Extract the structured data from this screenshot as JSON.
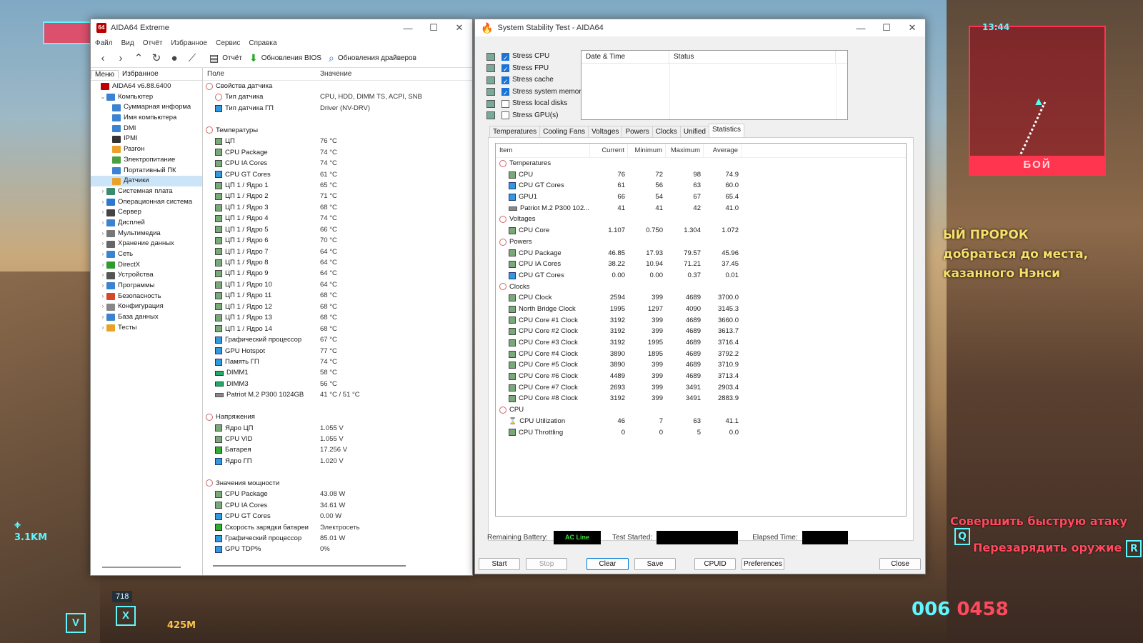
{
  "game_hud": {
    "clock": "13:44",
    "minimap_label": "БОЙ",
    "quest_title": "ЫЙ ПРОРОК",
    "quest_line1": "добраться до места,",
    "quest_line2": "казанного Нэнси",
    "hint_attack": "Совершить быструю атаку",
    "hint_attack_key": "Q",
    "hint_reload": "Перезарядить оружие",
    "hint_reload_key": "R",
    "ammo_main": "006",
    "ammo_reserve": "0458",
    "distance": "3.1KM",
    "distance2": "425M",
    "hud_num": "718",
    "slot_x": "X",
    "slot_v": "V"
  },
  "aida": {
    "title": "AIDA64 Extreme",
    "app_icon": "64",
    "menu": [
      "Файл",
      "Вид",
      "Отчёт",
      "Избранное",
      "Сервис",
      "Справка"
    ],
    "toolbar": {
      "report": "Отчёт",
      "bios": "Обновления BIOS",
      "drivers": "Обновления драйверов"
    },
    "pane_tabs": {
      "menu": "Меню",
      "favorites": "Избранное"
    },
    "tree": [
      {
        "label": "AIDA64 v6.88.6400",
        "level": 0,
        "color": "#c00000",
        "exp": ""
      },
      {
        "label": "Компьютер",
        "level": 1,
        "color": "#3b83d1",
        "exp": "⌄"
      },
      {
        "label": "Суммарная информа",
        "level": 2,
        "color": "#3b83d1",
        "exp": ""
      },
      {
        "label": "Имя компьютера",
        "level": 2,
        "color": "#3b83d1",
        "exp": ""
      },
      {
        "label": "DMI",
        "level": 2,
        "color": "#3b83d1",
        "exp": ""
      },
      {
        "label": "IPMI",
        "level": 2,
        "color": "#333333",
        "exp": ""
      },
      {
        "label": "Разгон",
        "level": 2,
        "color": "#e8a22a",
        "exp": ""
      },
      {
        "label": "Электропитание",
        "level": 2,
        "color": "#4aa040",
        "exp": ""
      },
      {
        "label": "Портативный ПК",
        "level": 2,
        "color": "#3b83d1",
        "exp": ""
      },
      {
        "label": "Датчики",
        "level": 2,
        "color": "#e8a22a",
        "exp": "",
        "selected": true
      },
      {
        "label": "Системная плата",
        "level": 1,
        "color": "#3b8a6a",
        "exp": "›"
      },
      {
        "label": "Операционная система",
        "level": 1,
        "color": "#2a78d6",
        "exp": "›"
      },
      {
        "label": "Сервер",
        "level": 1,
        "color": "#444444",
        "exp": "›"
      },
      {
        "label": "Дисплей",
        "level": 1,
        "color": "#3b83d1",
        "exp": "›"
      },
      {
        "label": "Мультимедиа",
        "level": 1,
        "color": "#777777",
        "exp": "›"
      },
      {
        "label": "Хранение данных",
        "level": 1,
        "color": "#666666",
        "exp": "›"
      },
      {
        "label": "Сеть",
        "level": 1,
        "color": "#3b83d1",
        "exp": "›"
      },
      {
        "label": "DirectX",
        "level": 1,
        "color": "#2f9a2f",
        "exp": "›"
      },
      {
        "label": "Устройства",
        "level": 1,
        "color": "#555555",
        "exp": "›"
      },
      {
        "label": "Программы",
        "level": 1,
        "color": "#3b83d1",
        "exp": "›"
      },
      {
        "label": "Безопасность",
        "level": 1,
        "color": "#d6472a",
        "exp": "›"
      },
      {
        "label": "Конфигурация",
        "level": 1,
        "color": "#888888",
        "exp": "›"
      },
      {
        "label": "База данных",
        "level": 1,
        "color": "#3b83d1",
        "exp": "›"
      },
      {
        "label": "Тесты",
        "level": 1,
        "color": "#e8a22a",
        "exp": "›"
      }
    ],
    "columns": {
      "field": "Поле",
      "value": "Значение"
    },
    "sensors": [
      {
        "type": "group",
        "name": "Свойства датчика",
        "value": ""
      },
      {
        "type": "item",
        "name": "Тип датчика",
        "value": "CPU, HDD, DIMM TS, ACPI, SNB",
        "icon": "gi"
      },
      {
        "type": "item",
        "name": "Тип датчика ГП",
        "value": "Driver  (NV-DRV)",
        "icon": "blue"
      },
      {
        "type": "space"
      },
      {
        "type": "group",
        "name": "Температуры",
        "value": ""
      },
      {
        "type": "item",
        "name": "ЦП",
        "value": "76 °C",
        "icon": "std"
      },
      {
        "type": "item",
        "name": "CPU Package",
        "value": "74 °C",
        "icon": "std"
      },
      {
        "type": "item",
        "name": "CPU IA Cores",
        "value": "74 °C",
        "icon": "std"
      },
      {
        "type": "item",
        "name": "CPU GT Cores",
        "value": "61 °C",
        "icon": "blue"
      },
      {
        "type": "item",
        "name": "ЦП 1 / Ядро 1",
        "value": "65 °C",
        "icon": "std"
      },
      {
        "type": "item",
        "name": "ЦП 1 / Ядро 2",
        "value": "71 °C",
        "icon": "std"
      },
      {
        "type": "item",
        "name": "ЦП 1 / Ядро 3",
        "value": "68 °C",
        "icon": "std"
      },
      {
        "type": "item",
        "name": "ЦП 1 / Ядро 4",
        "value": "74 °C",
        "icon": "std"
      },
      {
        "type": "item",
        "name": "ЦП 1 / Ядро 5",
        "value": "66 °C",
        "icon": "std"
      },
      {
        "type": "item",
        "name": "ЦП 1 / Ядро 6",
        "value": "70 °C",
        "icon": "std"
      },
      {
        "type": "item",
        "name": "ЦП 1 / Ядро 7",
        "value": "64 °C",
        "icon": "std"
      },
      {
        "type": "item",
        "name": "ЦП 1 / Ядро 8",
        "value": "64 °C",
        "icon": "std"
      },
      {
        "type": "item",
        "name": "ЦП 1 / Ядро 9",
        "value": "64 °C",
        "icon": "std"
      },
      {
        "type": "item",
        "name": "ЦП 1 / Ядро 10",
        "value": "64 °C",
        "icon": "std"
      },
      {
        "type": "item",
        "name": "ЦП 1 / Ядро 11",
        "value": "68 °C",
        "icon": "std"
      },
      {
        "type": "item",
        "name": "ЦП 1 / Ядро 12",
        "value": "68 °C",
        "icon": "std"
      },
      {
        "type": "item",
        "name": "ЦП 1 / Ядро 13",
        "value": "68 °C",
        "icon": "std"
      },
      {
        "type": "item",
        "name": "ЦП 1 / Ядро 14",
        "value": "68 °C",
        "icon": "std"
      },
      {
        "type": "item",
        "name": "Графический процессор",
        "value": "67 °C",
        "icon": "blue"
      },
      {
        "type": "item",
        "name": "GPU Hotspot",
        "value": "77 °C",
        "icon": "blue"
      },
      {
        "type": "item",
        "name": "Память ГП",
        "value": "74 °C",
        "icon": "blue"
      },
      {
        "type": "item",
        "name": "DIMM1",
        "value": "58 °C",
        "icon": "ram"
      },
      {
        "type": "item",
        "name": "DIMM3",
        "value": "56 °C",
        "icon": "ram"
      },
      {
        "type": "item",
        "name": "Patriot M.2 P300 1024GB",
        "value": "41 °C / 51 °C",
        "icon": "disk"
      },
      {
        "type": "space"
      },
      {
        "type": "group",
        "name": "Напряжения",
        "value": ""
      },
      {
        "type": "item",
        "name": "Ядро ЦП",
        "value": "1.055 V",
        "icon": "std"
      },
      {
        "type": "item",
        "name": "CPU VID",
        "value": "1.055 V",
        "icon": "std"
      },
      {
        "type": "item",
        "name": "Батарея",
        "value": "17.256 V",
        "icon": "green"
      },
      {
        "type": "item",
        "name": "Ядро ГП",
        "value": "1.020 V",
        "icon": "blue"
      },
      {
        "type": "space"
      },
      {
        "type": "group",
        "name": "Значения мощности",
        "value": ""
      },
      {
        "type": "item",
        "name": "CPU Package",
        "value": "43.08 W",
        "icon": "std"
      },
      {
        "type": "item",
        "name": "CPU IA Cores",
        "value": "34.61 W",
        "icon": "std"
      },
      {
        "type": "item",
        "name": "CPU GT Cores",
        "value": "0.00 W",
        "icon": "blue"
      },
      {
        "type": "item",
        "name": "Скорость зарядки батареи",
        "value": "Электросеть",
        "icon": "green"
      },
      {
        "type": "item",
        "name": "Графический процессор",
        "value": "85.01 W",
        "icon": "blue"
      },
      {
        "type": "item",
        "name": "GPU TDP%",
        "value": "0%",
        "icon": "blue"
      }
    ]
  },
  "sst": {
    "title": "System Stability Test - AIDA64",
    "options": [
      {
        "label": "Stress CPU",
        "checked": true
      },
      {
        "label": "Stress FPU",
        "checked": true
      },
      {
        "label": "Stress cache",
        "checked": true
      },
      {
        "label": "Stress system memory",
        "checked": true
      },
      {
        "label": "Stress local disks",
        "checked": false
      },
      {
        "label": "Stress GPU(s)",
        "checked": false
      }
    ],
    "log_columns": {
      "date": "Date & Time",
      "status": "Status"
    },
    "tabs": [
      "Temperatures",
      "Cooling Fans",
      "Voltages",
      "Powers",
      "Clocks",
      "Unified",
      "Statistics"
    ],
    "active_tab": "Statistics",
    "stats_columns": {
      "item": "Item",
      "current": "Current",
      "minimum": "Minimum",
      "maximum": "Maximum",
      "average": "Average"
    },
    "stats": [
      {
        "type": "grp",
        "name": "Temperatures"
      },
      {
        "type": "it",
        "name": "CPU",
        "cur": "76",
        "min": "72",
        "max": "98",
        "avg": "74.9",
        "icon": "std"
      },
      {
        "type": "it",
        "name": "CPU GT Cores",
        "cur": "61",
        "min": "56",
        "max": "63",
        "avg": "60.0",
        "icon": "blue"
      },
      {
        "type": "it",
        "name": "GPU1",
        "cur": "66",
        "min": "54",
        "max": "67",
        "avg": "65.4",
        "icon": "blue"
      },
      {
        "type": "it",
        "name": "Patriot M.2 P300 102...",
        "cur": "41",
        "min": "41",
        "max": "42",
        "avg": "41.0",
        "icon": "disk"
      },
      {
        "type": "grp",
        "name": "Voltages"
      },
      {
        "type": "it",
        "name": "CPU Core",
        "cur": "1.107",
        "min": "0.750",
        "max": "1.304",
        "avg": "1.072",
        "icon": "std"
      },
      {
        "type": "grp",
        "name": "Powers"
      },
      {
        "type": "it",
        "name": "CPU Package",
        "cur": "46.85",
        "min": "17.93",
        "max": "79.57",
        "avg": "45.96",
        "icon": "std"
      },
      {
        "type": "it",
        "name": "CPU IA Cores",
        "cur": "38.22",
        "min": "10.94",
        "max": "71.21",
        "avg": "37.45",
        "icon": "std"
      },
      {
        "type": "it",
        "name": "CPU GT Cores",
        "cur": "0.00",
        "min": "0.00",
        "max": "0.37",
        "avg": "0.01",
        "icon": "blue"
      },
      {
        "type": "grp",
        "name": "Clocks"
      },
      {
        "type": "it",
        "name": "CPU Clock",
        "cur": "2594",
        "min": "399",
        "max": "4689",
        "avg": "3700.0",
        "icon": "std"
      },
      {
        "type": "it",
        "name": "North Bridge Clock",
        "cur": "1995",
        "min": "1297",
        "max": "4090",
        "avg": "3145.3",
        "icon": "std"
      },
      {
        "type": "it",
        "name": "CPU Core #1 Clock",
        "cur": "3192",
        "min": "399",
        "max": "4689",
        "avg": "3660.0",
        "icon": "std"
      },
      {
        "type": "it",
        "name": "CPU Core #2 Clock",
        "cur": "3192",
        "min": "399",
        "max": "4689",
        "avg": "3613.7",
        "icon": "std"
      },
      {
        "type": "it",
        "name": "CPU Core #3 Clock",
        "cur": "3192",
        "min": "1995",
        "max": "4689",
        "avg": "3716.4",
        "icon": "std"
      },
      {
        "type": "it",
        "name": "CPU Core #4 Clock",
        "cur": "3890",
        "min": "1895",
        "max": "4689",
        "avg": "3792.2",
        "icon": "std"
      },
      {
        "type": "it",
        "name": "CPU Core #5 Clock",
        "cur": "3890",
        "min": "399",
        "max": "4689",
        "avg": "3710.9",
        "icon": "std"
      },
      {
        "type": "it",
        "name": "CPU Core #6 Clock",
        "cur": "4489",
        "min": "399",
        "max": "4689",
        "avg": "3713.4",
        "icon": "std"
      },
      {
        "type": "it",
        "name": "CPU Core #7 Clock",
        "cur": "2693",
        "min": "399",
        "max": "3491",
        "avg": "2903.4",
        "icon": "std"
      },
      {
        "type": "it",
        "name": "CPU Core #8 Clock",
        "cur": "3192",
        "min": "399",
        "max": "3491",
        "avg": "2883.9",
        "icon": "std"
      },
      {
        "type": "grp",
        "name": "CPU"
      },
      {
        "type": "it",
        "name": "CPU Utilization",
        "cur": "46",
        "min": "7",
        "max": "63",
        "avg": "41.1",
        "icon": "hourglass"
      },
      {
        "type": "it",
        "name": "CPU Throttling",
        "cur": "0",
        "min": "0",
        "max": "5",
        "avg": "0.0",
        "icon": "std"
      }
    ],
    "labels": {
      "battery": "Remaining Battery:",
      "ac_line": "AC Line",
      "test_started": "Test Started:",
      "elapsed": "Elapsed Time:"
    },
    "buttons": {
      "start": "Start",
      "stop": "Stop",
      "clear": "Clear",
      "save": "Save",
      "cpuid": "CPUID",
      "preferences": "Preferences",
      "close": "Close"
    }
  }
}
